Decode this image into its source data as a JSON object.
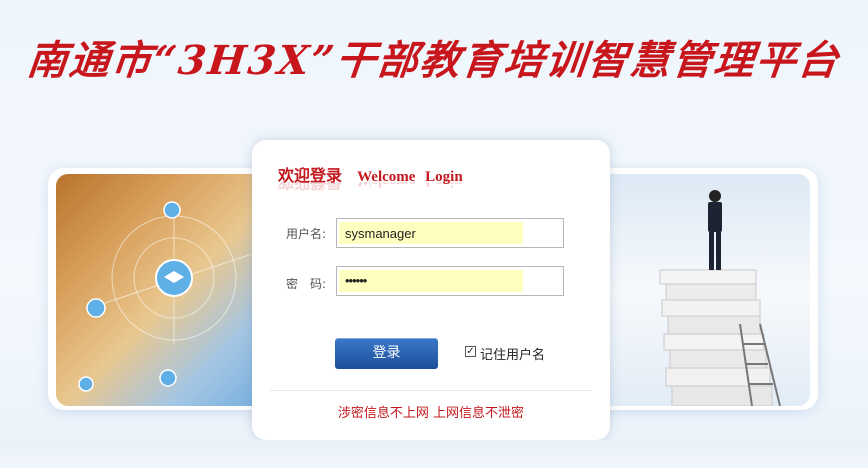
{
  "header": {
    "title": "南通市“3H3X”干部教育培训智慧管理平台"
  },
  "login": {
    "heading_cn": "欢迎登录",
    "heading_en": "Welcome  Login",
    "username_label": "用户名:",
    "username_value": "sysmanager",
    "password_label": "密　码:",
    "password_value": "••••••",
    "submit_label": "登录",
    "remember_label": "记住用户名",
    "remember_checked": "✓",
    "notice": "涉密信息不上网  上网信息不泄密"
  },
  "colors": {
    "brand_red": "#c8161d",
    "button_blue": "#2a63b0",
    "autofill_yellow": "#ffffc0"
  }
}
